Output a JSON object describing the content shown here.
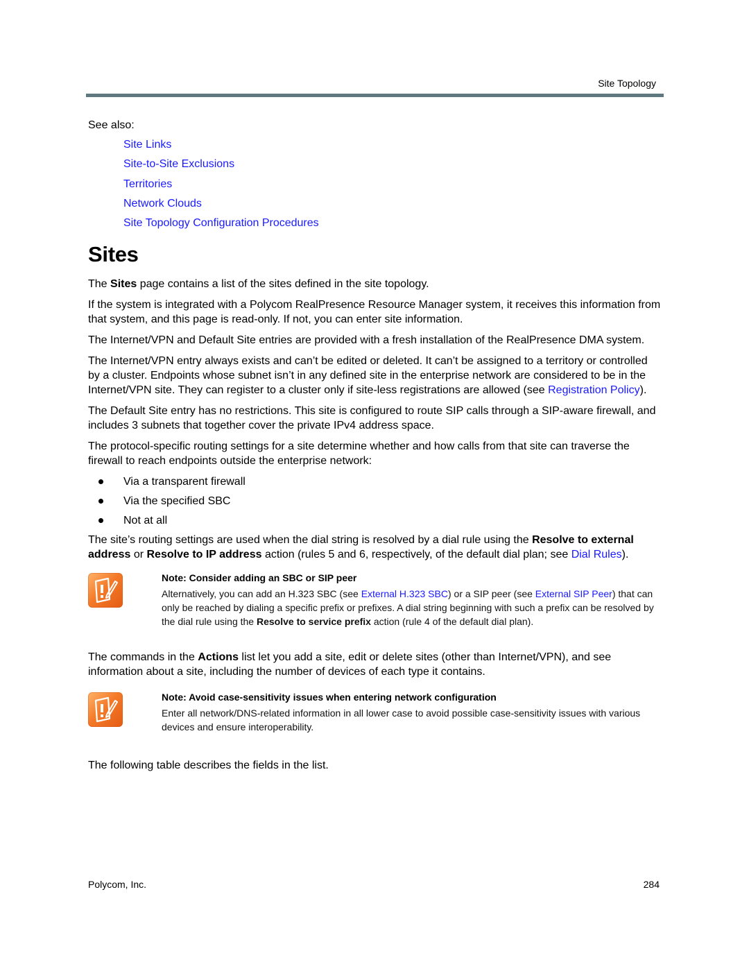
{
  "header": {
    "section_title": "Site Topology"
  },
  "see_also": {
    "label": "See also:",
    "links": [
      "Site Links",
      "Site-to-Site Exclusions",
      "Territories",
      "Network Clouds",
      "Site Topology Configuration Procedures"
    ]
  },
  "section": {
    "title": "Sites",
    "p1": {
      "pre": "The ",
      "bold": "Sites",
      "post": " page contains a list of the sites defined in the site topology."
    },
    "p2": "If the system is integrated with a Polycom RealPresence Resource Manager system, it receives this information from that system, and this page is read-only. If not, you can enter site information.",
    "p3": "The Internet/VPN and Default Site entries are provided with a fresh installation of the RealPresence DMA system.",
    "p4": {
      "pre": "The Internet/VPN entry always exists and can’t be edited or deleted. It can’t be assigned to a territory or controlled by a cluster. Endpoints whose subnet isn’t in any defined site in the enterprise network are considered to be in the Internet/VPN site. They can register to a cluster only if site-less registrations are allowed (see ",
      "link": "Registration Policy",
      "post": ")."
    },
    "p5": "The Default Site entry has no restrictions. This site is configured to route SIP calls through a SIP-aware firewall, and includes 3 subnets that together cover the private IPv4 address space.",
    "p6": "The protocol-specific routing settings for a site determine whether and how calls from that site can traverse the firewall to reach endpoints outside the enterprise network:",
    "bullets": [
      "Via a transparent firewall",
      "Via the specified SBC",
      "Not at all"
    ],
    "p7": {
      "t1": "The site’s routing settings are used when the dial string is resolved by a dial rule using the ",
      "b1": "Resolve to external address",
      "t2": " or ",
      "b2": "Resolve to IP address",
      "t3": " action (rules 5 and 6, respectively, of the default dial plan; see ",
      "link": "Dial Rules",
      "t4": ")."
    },
    "note1": {
      "title": "Note: Consider adding an SBC or SIP peer",
      "t1": "Alternatively, you can add an H.323 SBC (see ",
      "link1": "External H.323 SBC",
      "t2": ") or a SIP peer (see ",
      "link2": "External SIP Peer",
      "t3": ") that can only be reached by dialing a specific prefix or prefixes. A dial string beginning with such a prefix can be resolved by the dial rule using the ",
      "bold": "Resolve to service prefix",
      "t4": " action (rule 4 of the default dial plan)."
    },
    "p8": {
      "pre": "The commands in the ",
      "bold": "Actions",
      "post": " list let you add a site, edit or delete sites (other than Internet/VPN), and see information about a site, including the number of devices of each type it contains."
    },
    "note2": {
      "title": "Note: Avoid case-sensitivity issues when entering network configuration",
      "body": "Enter all network/DNS-related information in all lower case to avoid possible case-sensitivity issues with various devices and ensure interoperability."
    },
    "p9": "The following table describes the fields in the list."
  },
  "footer": {
    "company": "Polycom, Inc.",
    "page_number": "284"
  }
}
